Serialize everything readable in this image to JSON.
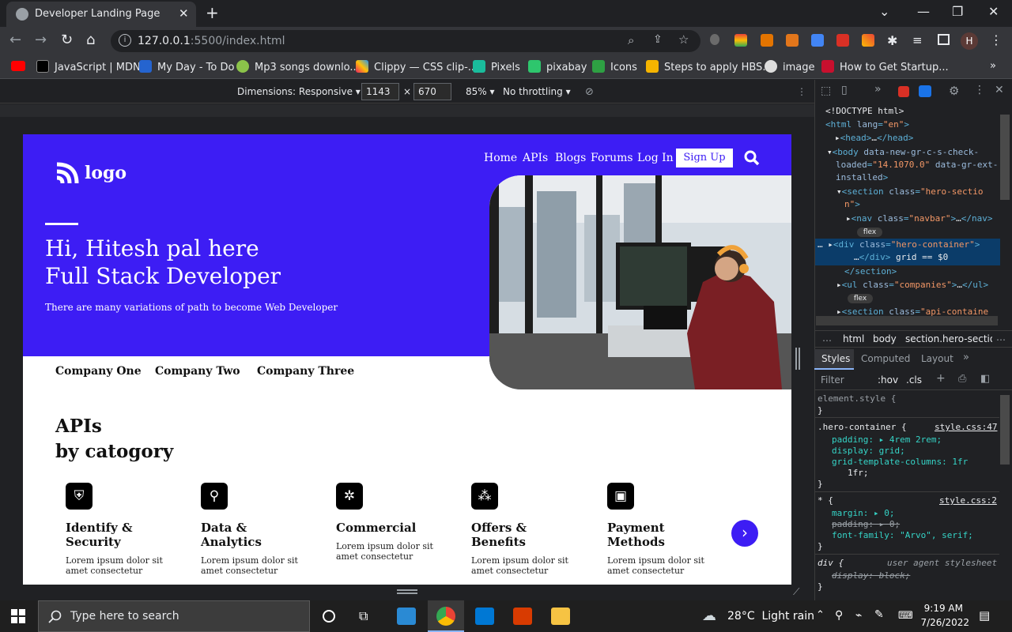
{
  "browser": {
    "tab_title": "Developer Landing Page",
    "url_host": "127.0.0.1",
    "url_rest": ":5500/index.html",
    "profile_initial": "H",
    "bookmarks": [
      "JavaScript | MDN",
      "My Day - To Do",
      "Mp3 songs downlo...",
      "Clippy — CSS clip-...",
      "Pixels",
      "pixabay",
      "Icons",
      "Steps to apply HBS...",
      "image",
      "How to Get Startup..."
    ]
  },
  "device_toolbar": {
    "dimensions_label": "Dimensions: Responsive",
    "width": "1143",
    "times": "×",
    "height": "670",
    "zoom": "85%",
    "throttling": "No throttling"
  },
  "site": {
    "logo_text": "logo",
    "nav": [
      "Home",
      "APIs",
      "Blogs",
      "Forums",
      "Log In"
    ],
    "signup": "Sign Up",
    "hero_line1": "Hi, Hitesh pal here",
    "hero_line2": "Full Stack Developer",
    "hero_sub": "There are many variations of path to become Web Developer",
    "companies": [
      "Company One",
      "Company Two",
      "Company Three"
    ],
    "apis_line1": "APIs",
    "apis_line2": "by catogory",
    "cards": [
      {
        "title": "Identify & Security",
        "desc": "Lorem ipsum dolor sit amet consectetur",
        "icon": "shield-icon"
      },
      {
        "title": "Data & Analytics",
        "desc": "Lorem ipsum dolor sit amet consectetur",
        "icon": "analytics-icon"
      },
      {
        "title": "Commercial",
        "desc": "Lorem ipsum dolor sit amet consectetur",
        "icon": "network-icon"
      },
      {
        "title": "Offers & Benefits",
        "desc": "Lorem ipsum dolor sit amet consectetur",
        "icon": "offers-icon"
      },
      {
        "title": "Payment Methods",
        "desc": "Lorem ipsum dolor sit amet consectetur",
        "icon": "payment-icon"
      }
    ]
  },
  "devtools": {
    "tabs": [
      "Styles",
      "Computed",
      "Layout"
    ],
    "filter_placeholder": "Filter",
    "hov": ":hov",
    "cls": ".cls",
    "breadcrumb": [
      "html",
      "body",
      "section.hero-section"
    ],
    "rule1_selector": ".hero-container {",
    "rule1_source": "style.css:47",
    "rule1_p1": "padding: ▸ 4rem 2rem;",
    "rule1_p2": "display: grid;",
    "rule1_p3": "grid-template-columns: 1fr",
    "rule1_p3b": "1fr;",
    "rule2_selector": "* {",
    "rule2_source": "style.css:2",
    "rule2_p1": "margin: ▸ 0;",
    "rule2_p2": "padding: ▸ 0;",
    "rule2_p3": "font-family: \"Arvo\", serif;",
    "rule3_selector": "div {",
    "rule3_source": "user agent stylesheet",
    "rule3_p1": "display: block;"
  },
  "taskbar": {
    "search_placeholder": "Type here to search",
    "weather": "28°C  Light rain",
    "time": "9:19 AM",
    "date": "7/26/2022"
  },
  "colors": {
    "brand": "#3d1df4",
    "devtools_tag": "#5db0d7",
    "devtools_value": "#f29766"
  }
}
